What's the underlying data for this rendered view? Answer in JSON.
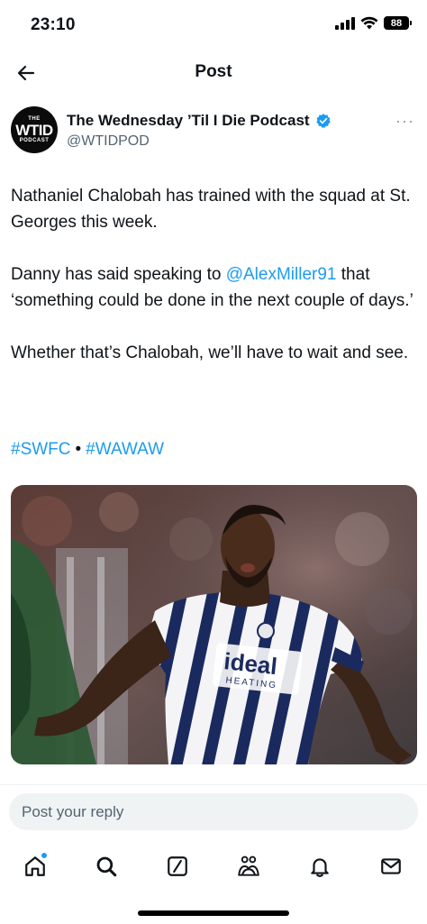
{
  "status_bar": {
    "time": "23:10",
    "battery": "88",
    "icons": [
      "signal-icon",
      "wifi-icon",
      "battery-icon"
    ]
  },
  "header": {
    "title": "Post",
    "back_icon": "arrow-left-icon"
  },
  "author": {
    "name": "The Wednesday ’Til I Die Podcast",
    "handle": "@WTIDPOD",
    "verified": true,
    "avatar_logo": {
      "top": "THE",
      "main": "WTID",
      "bottom": "PODCAST"
    },
    "more_icon": "more-horizontal-icon",
    "more_label": "···"
  },
  "tweet": {
    "paragraph_1": "Nathaniel Chalobah has trained with the squad at St. Georges this week.",
    "paragraph_2_before": "Danny has said speaking to ",
    "mention": "@AlexMiller91",
    "paragraph_2_after": " that ‘something could be done in the next couple of days.’",
    "paragraph_3": "Whether that’s Chalobah, we’ll have to wait and see.",
    "hashtags": [
      "#SWFC",
      "#WAWAW"
    ],
    "hashtag_separator": "•",
    "media": {
      "kit_sponsor": "ideal",
      "kit_sponsor_sub": "HEATING"
    }
  },
  "reply": {
    "placeholder": "Post your reply"
  },
  "bottom_nav": {
    "items": [
      "home-icon",
      "search-icon",
      "grok-icon",
      "communities-icon",
      "notifications-icon",
      "messages-icon"
    ],
    "home_has_notification": true
  },
  "colors": {
    "accent": "#1d9bf0",
    "text": "#0f1419",
    "secondary_text": "#536471",
    "reply_bg": "#eff3f4"
  }
}
